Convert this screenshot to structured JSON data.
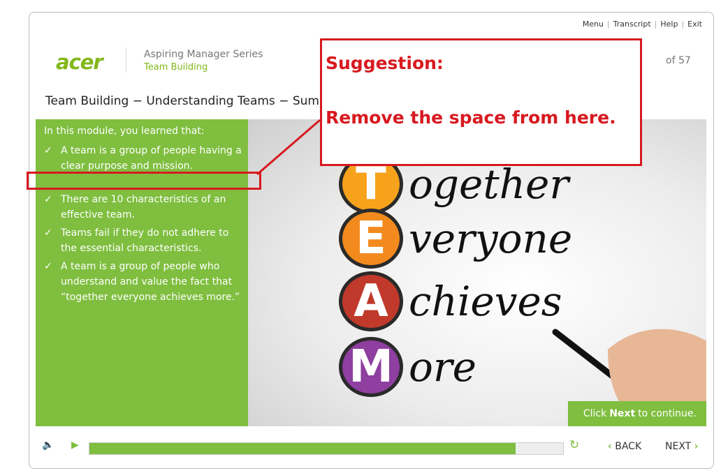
{
  "topnav": {
    "menu": "Menu",
    "transcript": "Transcript",
    "help": "Help",
    "exit": "Exit"
  },
  "brand": {
    "logo_text": "acer",
    "series": "Aspiring Manager Series",
    "course": "Team Building",
    "accent": "#7fbe3f"
  },
  "header": {
    "page_count": "of 57"
  },
  "slide": {
    "title": "Team Building − Understanding Teams − Summ",
    "intro": "In this module, you learned that:",
    "points": [
      "A team is a group of people having a clear purpose and mission.",
      "There are 10 characteristics of an effective team.",
      "Teams fail if they do not adhere to the essential characteristics.",
      "A team is a group of people who understand and value the fact that “together everyone achieves more.”"
    ],
    "check_glyph": "✓"
  },
  "image": {
    "rows": [
      {
        "letter": "T",
        "rest": "ogether",
        "color": "#f6a21b"
      },
      {
        "letter": "E",
        "rest": "veryone",
        "color": "#f28a1e"
      },
      {
        "letter": "A",
        "rest": "chieves",
        "color": "#c0392b"
      },
      {
        "letter": "M",
        "rest": "ore",
        "color": "#8e3fa0"
      }
    ]
  },
  "cta": {
    "prefix": "Click",
    "bold": "Next",
    "suffix": "to continue."
  },
  "controls": {
    "progress": 0.9,
    "back_label": "BACK",
    "next_label": "NEXT"
  },
  "callout": {
    "heading": "Suggestion:",
    "body": "Remove the space from here.",
    "color": "#d71920"
  }
}
